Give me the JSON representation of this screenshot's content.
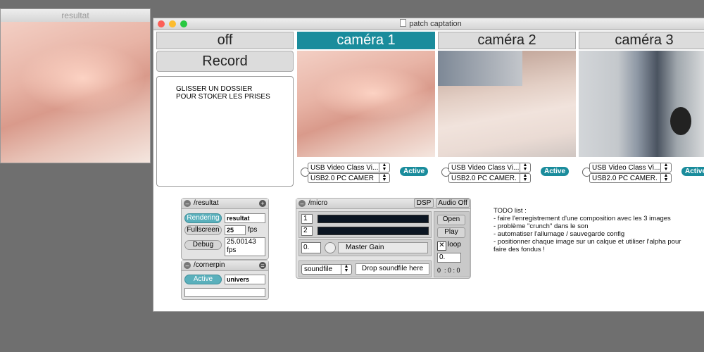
{
  "window_resultat": {
    "title": "resultat"
  },
  "window_main": {
    "title": "patch captation",
    "doc_icon": "document-icon"
  },
  "tabs": {
    "off": "off",
    "record": "Record",
    "cam1": "caméra 1",
    "cam2": "caméra 2",
    "cam3": "caméra 3"
  },
  "drop_zone": {
    "line1": "GLISSER UN DOSSIER",
    "line2": "POUR STOKER LES PRISES"
  },
  "cameras": [
    {
      "device": "USB Video Class Vi...",
      "input": "USB2.0 PC CAMER",
      "status": "Active"
    },
    {
      "device": "USB Video Class Vi...",
      "input": "USB2.0 PC CAMER.",
      "status": "Active"
    },
    {
      "device": "USB Video Class Vi...",
      "input": "USB2.0 PC CAMER.",
      "status": "Active"
    }
  ],
  "resultat_panel": {
    "title": "/resultat",
    "rendering": "Rendering",
    "rendering_value": "resultat",
    "fullscreen": "Fullscreen",
    "fps_value": "25",
    "fps_unit": "fps",
    "debug": "Debug",
    "debug_value": "25.00143",
    "debug_unit": "fps"
  },
  "cornerpin_panel": {
    "title": "/cornerpin",
    "active": "Active",
    "value": "univers"
  },
  "micro_panel": {
    "title": "/micro",
    "dsp": "DSP",
    "audio_off": "Audio Off",
    "ch1": "1",
    "ch2": "2",
    "open": "Open",
    "play": "Play",
    "gain_value": "0.",
    "master_gain": "Master Gain",
    "loop_check": "✕",
    "loop": "loop",
    "loop_value": "0.",
    "soundfile": "soundfile",
    "drop_soundfile": "Drop soundfile here",
    "time": "0  : 0 : 0"
  },
  "todo": {
    "header": "TODO list :",
    "items": [
      "- faire l'enregistrement d'une composition avec les 3 images",
      "- problème \"crunch\" dans le son",
      "- automatiser l'allumage / sauvegarde config",
      "- positionner chaque image sur un calque et utiliser l'alpha pour",
      "faire des fondus !"
    ]
  },
  "colors": {
    "accent": "#1a8c9c",
    "close": "#fc5f57",
    "minimize": "#fdbc2e",
    "zoom": "#28c840"
  }
}
